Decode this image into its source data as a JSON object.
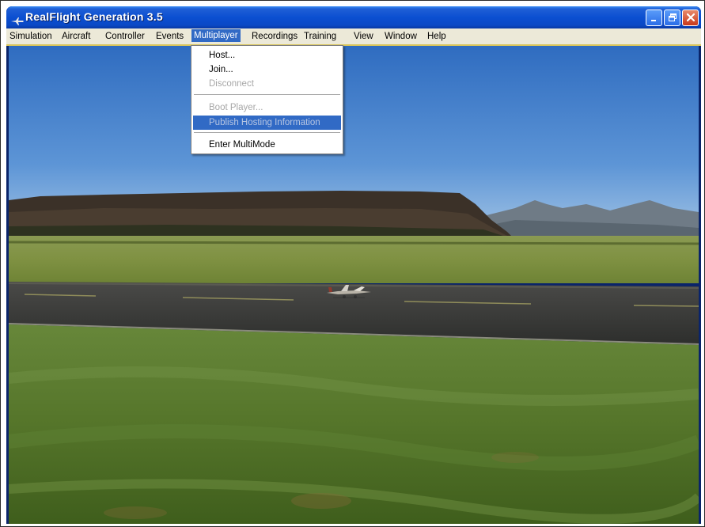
{
  "window": {
    "title": "RealFlight Generation 3.5",
    "app_icon": "plane-app-icon",
    "controls": [
      "minimize-icon",
      "restore-icon",
      "close-icon"
    ]
  },
  "menubar": {
    "items": [
      {
        "label": "Simulation"
      },
      {
        "label": "Aircraft"
      },
      {
        "label": "Controller"
      },
      {
        "label": "Events"
      },
      {
        "label": "Multiplayer",
        "active": true
      },
      {
        "label": "Recordings"
      },
      {
        "label": "Training"
      },
      {
        "label": "View"
      },
      {
        "label": "Window"
      },
      {
        "label": "Help"
      }
    ]
  },
  "multiplayer_menu": {
    "items": [
      {
        "label": "Host...",
        "enabled": true
      },
      {
        "label": "Join...",
        "enabled": true
      },
      {
        "label": "Disconnect",
        "enabled": false
      },
      {
        "label": "Boot Player...",
        "enabled": false
      },
      {
        "label": "Publish Hosting Information",
        "enabled": false,
        "highlighted": true
      },
      {
        "label": "Enter MultiMode",
        "enabled": true
      }
    ]
  },
  "colors": {
    "titlebar": "#0b4fd1",
    "menu_highlight": "#316ac5",
    "menubar_bg": "#ece9d8",
    "sky": "#4a84cc",
    "grass": "#4f6e22",
    "runway": "#3a3a3a"
  }
}
